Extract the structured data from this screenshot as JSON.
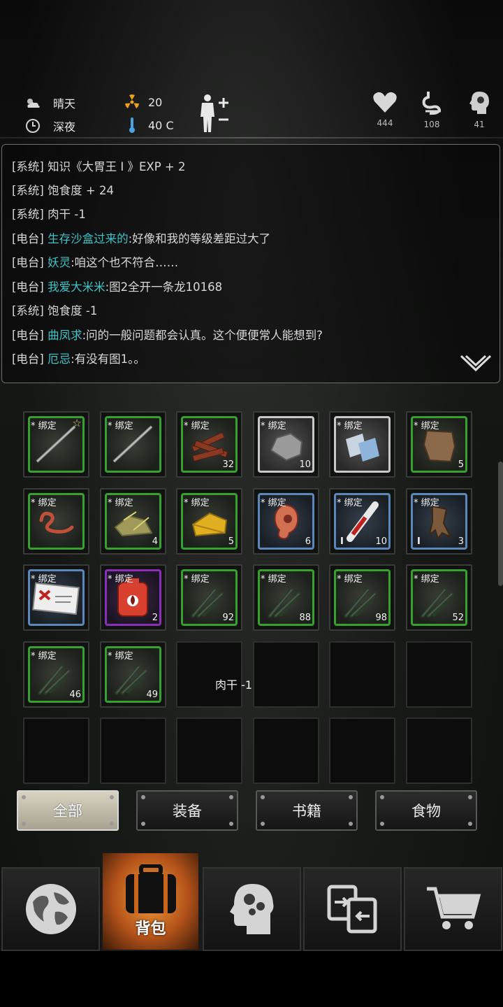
{
  "status": {
    "weather": "晴天",
    "time_of_day": "深夜",
    "radiation": "20",
    "temperature": "40 C",
    "health": "444",
    "satiety": "108",
    "sanity": "41"
  },
  "log": {
    "lines": [
      {
        "tag": "[系统]",
        "name": "",
        "text": "知识《大胃王 I 》EXP + 2"
      },
      {
        "tag": "[系统]",
        "name": "",
        "text": "饱食度 + 24"
      },
      {
        "tag": "[系统]",
        "name": "",
        "text": "肉干 -1"
      },
      {
        "tag": "[电台]",
        "name": "生存沙盒过来的",
        "text": ":好像和我的等级差距过大了"
      },
      {
        "tag": "[电台]",
        "name": "妖灵",
        "text": ":咱这个也不符合……"
      },
      {
        "tag": "[电台]",
        "name": "我爱大米米",
        "text": ":图2全开一条龙10168"
      },
      {
        "tag": "[系统]",
        "name": "",
        "text": "饱食度 -1"
      },
      {
        "tag": "[电台]",
        "name": "曲凤求",
        "text": ":问的一般问题都会认真。这个便便常人能想到?"
      },
      {
        "tag": "[电台]",
        "name": "厄忌",
        "text": ":有没有图1。。"
      }
    ]
  },
  "inventory": {
    "slots": [
      {
        "bind": "* 绑定",
        "count": "",
        "star": "☆",
        "level": "",
        "rarity": "green",
        "icon": "rod-icon"
      },
      {
        "bind": "* 绑定",
        "count": "",
        "star": "",
        "level": "",
        "rarity": "green",
        "icon": "rod-icon"
      },
      {
        "bind": "* 绑定",
        "count": "32",
        "star": "",
        "level": "",
        "rarity": "green",
        "icon": "wood-icon"
      },
      {
        "bind": "* 绑定",
        "count": "10",
        "star": "",
        "level": "",
        "rarity": "white",
        "icon": "stone-icon"
      },
      {
        "bind": "* 绑定",
        "count": "",
        "star": "",
        "level": "",
        "rarity": "white",
        "icon": "cloth-icon"
      },
      {
        "bind": "* 绑定",
        "count": "5",
        "star": "",
        "level": "",
        "rarity": "green",
        "icon": "leather-icon"
      },
      {
        "bind": "* 绑定",
        "count": "",
        "star": "",
        "level": "",
        "rarity": "green",
        "icon": "worm-icon"
      },
      {
        "bind": "* 绑定",
        "count": "4",
        "star": "",
        "level": "",
        "rarity": "green",
        "icon": "scrap-icon"
      },
      {
        "bind": "* 绑定",
        "count": "5",
        "star": "",
        "level": "",
        "rarity": "green",
        "icon": "cheese-icon"
      },
      {
        "bind": "* 绑定",
        "count": "6",
        "star": "",
        "level": "",
        "rarity": "blue",
        "icon": "ear-icon"
      },
      {
        "bind": "* 绑定",
        "count": "10",
        "star": "",
        "level": "I",
        "rarity": "blue",
        "icon": "syringe-icon"
      },
      {
        "bind": "* 绑定",
        "count": "3",
        "star": "",
        "level": "I",
        "rarity": "blue",
        "icon": "claw-icon"
      },
      {
        "bind": "* 绑定",
        "count": "",
        "star": "",
        "level": "",
        "rarity": "blue",
        "icon": "ticket-icon"
      },
      {
        "bind": "* 绑定",
        "count": "2",
        "star": "",
        "level": "",
        "rarity": "purple",
        "icon": "blood-bag-icon"
      },
      {
        "bind": "* 绑定",
        "count": "92",
        "star": "",
        "level": "",
        "rarity": "green",
        "icon": "herb-icon"
      },
      {
        "bind": "* 绑定",
        "count": "88",
        "star": "",
        "level": "",
        "rarity": "green",
        "icon": "herb-icon"
      },
      {
        "bind": "* 绑定",
        "count": "98",
        "star": "",
        "level": "",
        "rarity": "green",
        "icon": "herb-icon"
      },
      {
        "bind": "* 绑定",
        "count": "52",
        "star": "",
        "level": "",
        "rarity": "green",
        "icon": "herb-icon"
      },
      {
        "bind": "* 绑定",
        "count": "46",
        "star": "",
        "level": "",
        "rarity": "green",
        "icon": "herb-icon"
      },
      {
        "bind": "* 绑定",
        "count": "49",
        "star": "",
        "level": "",
        "rarity": "green",
        "icon": "herb-icon"
      },
      null,
      null,
      null,
      null,
      null,
      null,
      null,
      null,
      null,
      null
    ]
  },
  "toast": "肉干 -1",
  "filters": [
    {
      "label": "全部",
      "active": true
    },
    {
      "label": "装备",
      "active": false
    },
    {
      "label": "书籍",
      "active": false
    },
    {
      "label": "食物",
      "active": false
    }
  ],
  "nav": [
    {
      "name": "nav-map",
      "icon": "globe-icon",
      "label": ""
    },
    {
      "name": "nav-backpack",
      "icon": "backpack-icon",
      "label": "背包"
    },
    {
      "name": "nav-skills",
      "icon": "head-gears-icon",
      "label": ""
    },
    {
      "name": "nav-trade",
      "icon": "exchange-icon",
      "label": ""
    },
    {
      "name": "nav-shop",
      "icon": "cart-icon",
      "label": ""
    }
  ]
}
